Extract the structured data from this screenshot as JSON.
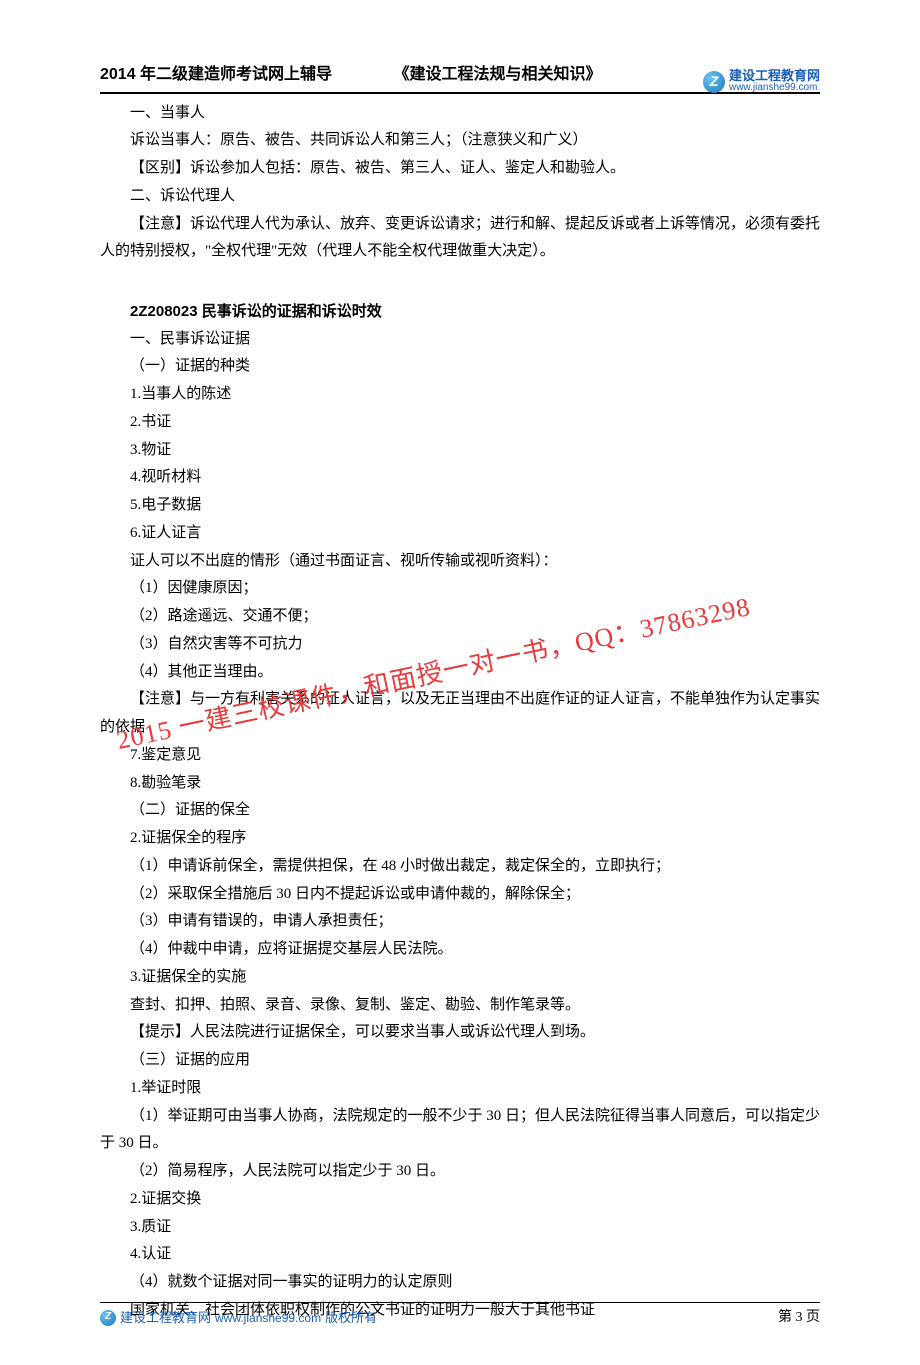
{
  "header": {
    "left": "2014 年二级建造师考试网上辅导",
    "mid": "《建设工程法规与相关知识》",
    "logo_cn": "建设工程教育网",
    "logo_url": "www.jianshe99.com"
  },
  "body": {
    "p01": "一、当事人",
    "p02": "诉讼当事人：原告、被告、共同诉讼人和第三人；（注意狭义和广义）",
    "p03": "【区别】诉讼参加人包括：原告、被告、第三人、证人、鉴定人和勘验人。",
    "p04": "二、诉讼代理人",
    "p05": "【注意】诉讼代理人代为承认、放弃、变更诉讼请求；进行和解、提起反诉或者上诉等情况，必须有委托人的特别授权，\"全权代理\"无效（代理人不能全权代理做重大决定）。",
    "sec_title": "2Z208023 民事诉讼的证据和诉讼时效",
    "p06": "一、民事诉讼证据",
    "p07": "（一）证据的种类",
    "p08": "1.当事人的陈述",
    "p09": "2.书证",
    "p10": "3.物证",
    "p11": "4.视听材料",
    "p12": "5.电子数据",
    "p13": "6.证人证言",
    "p14": "证人可以不出庭的情形（通过书面证言、视听传输或视听资料）：",
    "p15": "（1）因健康原因；",
    "p16": "（2）路途遥远、交通不便；",
    "p17": "（3）自然灾害等不可抗力",
    "p18": "（4）其他正当理由。",
    "p19": "【注意】与一方有利害关系的证人证言，以及无正当理由不出庭作证的证人证言，不能单独作为认定事实的依据",
    "p20": "7.鉴定意见",
    "p21": "8.勘验笔录",
    "p22": "（二）证据的保全",
    "p23": "2.证据保全的程序",
    "p24": "（1）申请诉前保全，需提供担保，在 48 小时做出裁定，裁定保全的，立即执行；",
    "p25": "（2）采取保全措施后 30 日内不提起诉讼或申请仲裁的，解除保全；",
    "p26": "（3）申请有错误的，申请人承担责任；",
    "p27": "（4）仲裁中申请，应将证据提交基层人民法院。",
    "p28": "3.证据保全的实施",
    "p29": "查封、扣押、拍照、录音、录像、复制、鉴定、勘验、制作笔录等。",
    "p30": "【提示】人民法院进行证据保全，可以要求当事人或诉讼代理人到场。",
    "p31": "（三）证据的应用",
    "p32": "1.举证时限",
    "p33": "（1）举证期可由当事人协商，法院规定的一般不少于 30 日；但人民法院征得当事人同意后，可以指定少于 30 日。",
    "p34": "（2）简易程序，人民法院可以指定少于 30 日。",
    "p35": "2.证据交换",
    "p36": "3.质证",
    "p37": "4.认证",
    "p38": "（4）就数个证据对同一事实的证明力的认定原则",
    "p39": "国家机关、社会团体依职权制作的公文书证的证明力一般大于其他书证"
  },
  "watermark": "2015 一建三校课件，和面授一对一书，QQ：37863298",
  "footer": {
    "site": "建设工程教育网",
    "url": "www.jianshe99.com",
    "copy": "版权所有",
    "page": "第 3 页"
  }
}
